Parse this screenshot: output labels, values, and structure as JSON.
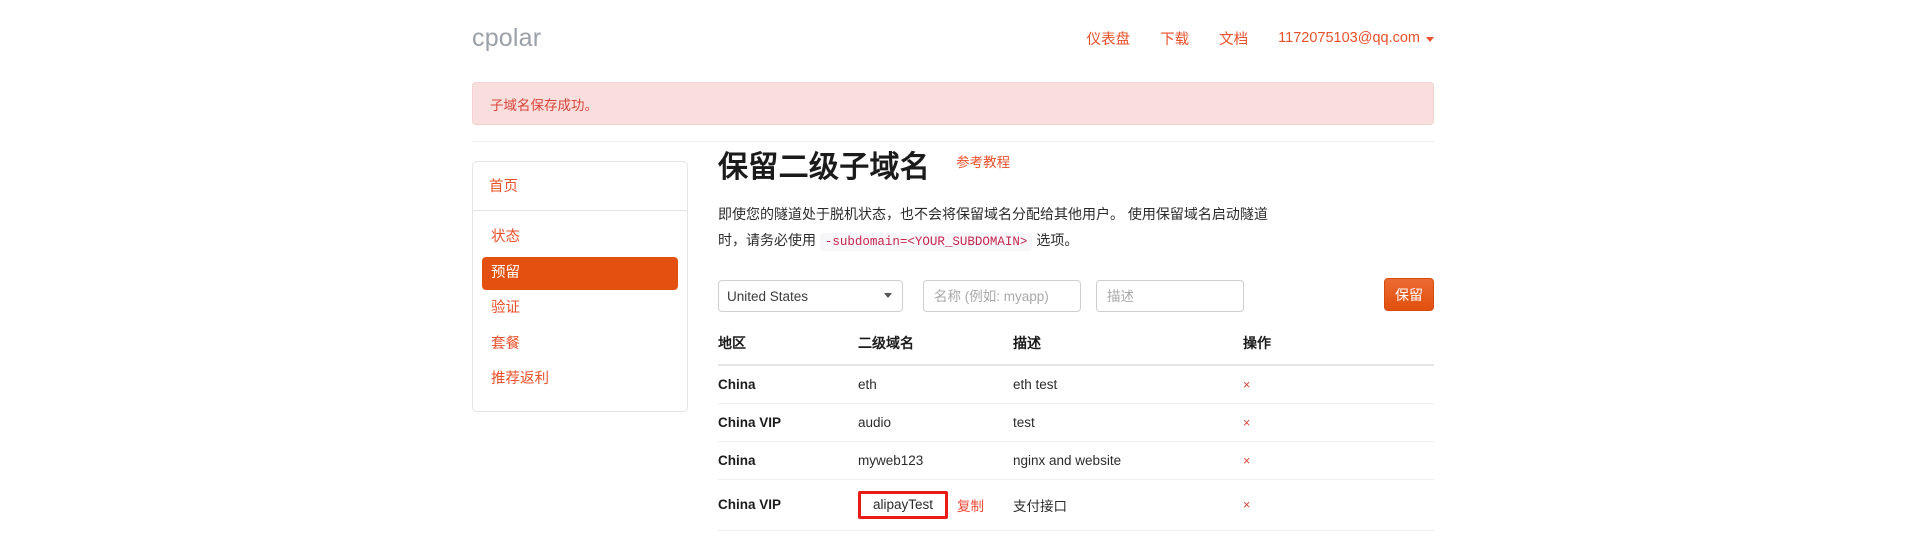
{
  "brand": "cpolar",
  "nav": {
    "links": [
      {
        "label": "仪表盘",
        "name": "nav-dashboard"
      },
      {
        "label": "下载",
        "name": "nav-download"
      },
      {
        "label": "文档",
        "name": "nav-docs"
      }
    ],
    "user": "1172075103@qq.com"
  },
  "alert": {
    "message": "子域名保存成功。"
  },
  "sidebar": {
    "home": "首页",
    "items": [
      {
        "label": "状态",
        "active": false
      },
      {
        "label": "预留",
        "active": true
      },
      {
        "label": "验证",
        "active": false
      },
      {
        "label": "套餐",
        "active": false
      },
      {
        "label": "推荐返利",
        "active": false
      }
    ]
  },
  "main": {
    "title": "保留二级子域名",
    "tutorial_link": "参考教程",
    "description_part1": "即使您的隧道处于脱机状态，也不会将保留域名分配给其他用户。 使用保留域名启动隧道时，请务必使用 ",
    "description_code": "-subdomain=<YOUR_SUBDOMAIN>",
    "description_part2": " 选项。"
  },
  "form": {
    "region_selected": "United States",
    "region_options": [
      "United States"
    ],
    "name_placeholder": "名称 (例如: myapp)",
    "name_value": "",
    "desc_placeholder": "描述",
    "desc_value": "",
    "submit_label": "保留"
  },
  "table": {
    "headers": {
      "region": "地区",
      "subdomain": "二级域名",
      "description": "描述",
      "action": "操作"
    },
    "delete_glyph": "×",
    "copy_label": "复制",
    "rows": [
      {
        "region": "China",
        "subdomain": "eth",
        "description": "eth test",
        "highlighted": false
      },
      {
        "region": "China VIP",
        "subdomain": "audio",
        "description": "test",
        "highlighted": false
      },
      {
        "region": "China",
        "subdomain": "myweb123",
        "description": "nginx and website",
        "highlighted": false
      },
      {
        "region": "China VIP",
        "subdomain": "alipayTest",
        "description": "支付接口",
        "highlighted": true
      }
    ]
  },
  "colors": {
    "accent": "#e8512a",
    "active_bg": "#e3500f",
    "alert_bg": "#f9dede",
    "alert_text": "#d9453a",
    "highlight_border": "#ea1b15",
    "code_text": "#c7254e"
  }
}
